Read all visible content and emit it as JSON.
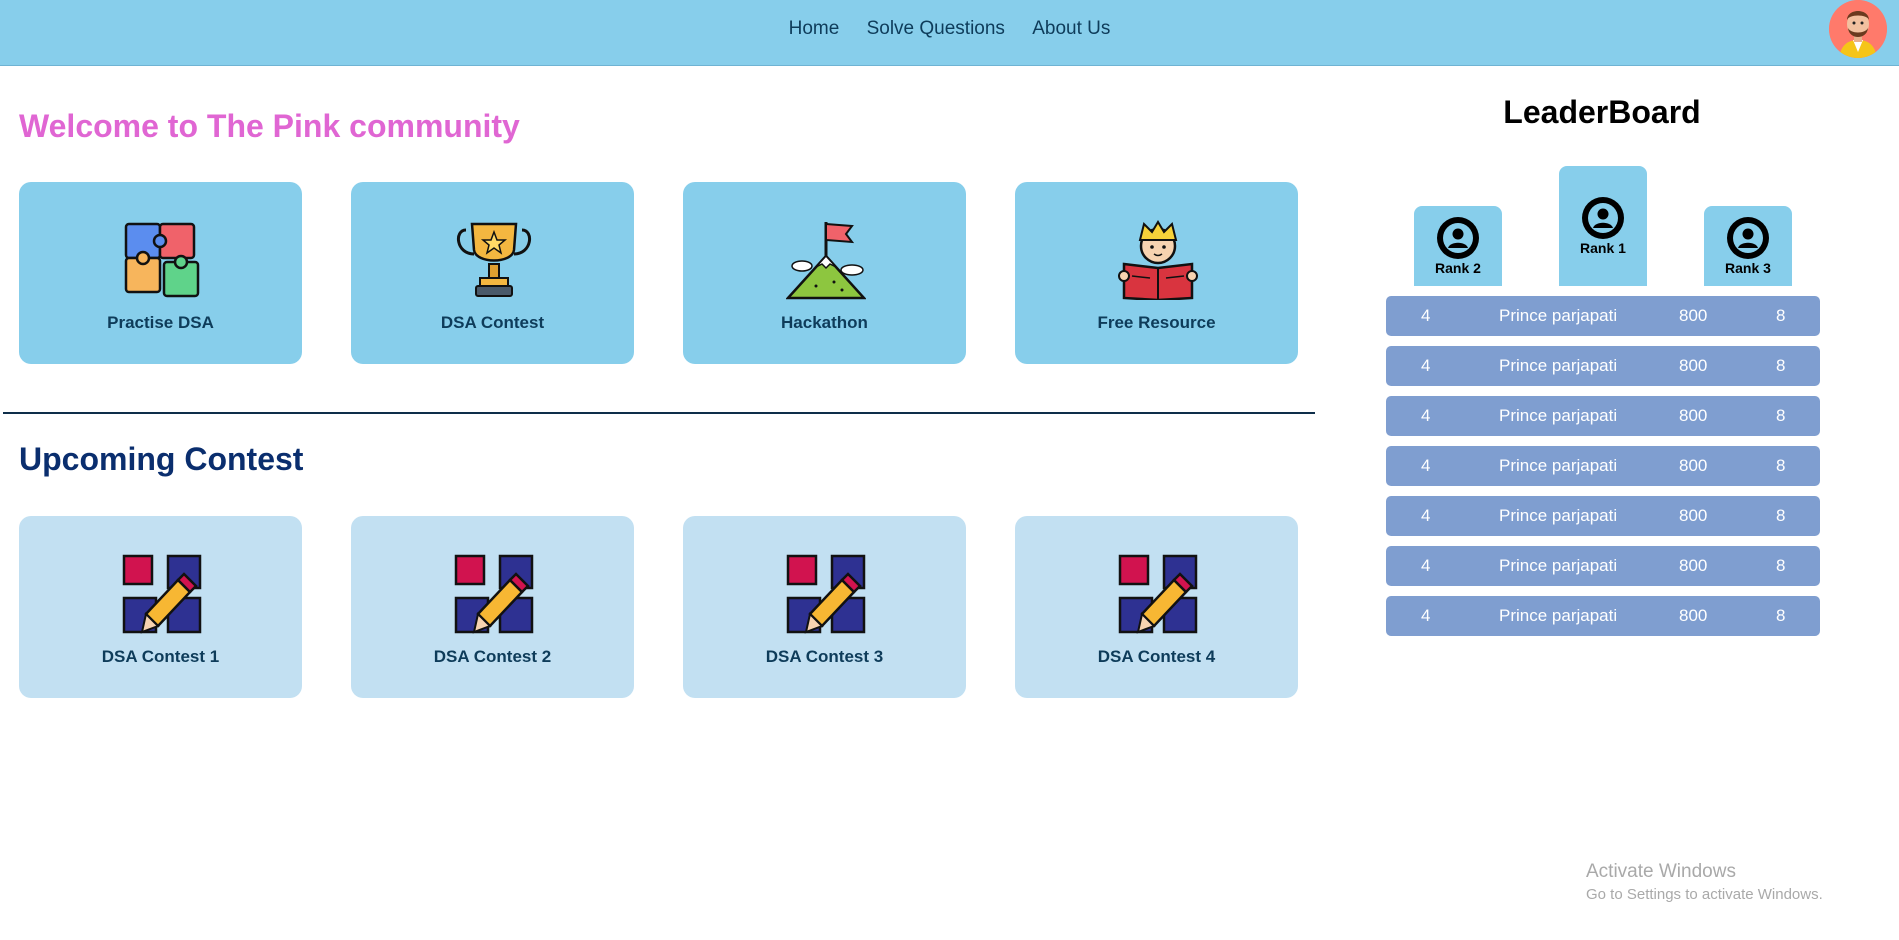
{
  "nav": {
    "links": [
      "Home",
      "Solve Questions",
      "About Us"
    ]
  },
  "welcome": {
    "title": "Welcome to The Pink community",
    "cards": [
      {
        "label": "Practise DSA",
        "icon": "puzzle-icon"
      },
      {
        "label": "DSA Contest",
        "icon": "trophy-icon"
      },
      {
        "label": "Hackathon",
        "icon": "mountain-flag-icon"
      },
      {
        "label": "Free Resource",
        "icon": "reading-kid-icon"
      }
    ]
  },
  "upcoming": {
    "title": "Upcoming Contest",
    "cards": [
      {
        "label": "DSA Contest 1",
        "icon": "blocks-pencil-icon"
      },
      {
        "label": "DSA Contest 2",
        "icon": "blocks-pencil-icon"
      },
      {
        "label": "DSA Contest 3",
        "icon": "blocks-pencil-icon"
      },
      {
        "label": "DSA Contest 4",
        "icon": "blocks-pencil-icon"
      }
    ]
  },
  "leaderboard": {
    "title": "LeaderBoard",
    "podium": {
      "second": "Rank 2",
      "first": "Rank 1",
      "third": "Rank 3"
    },
    "rows": [
      {
        "rank": "4",
        "name": "Prince parjapati",
        "score": "800",
        "solved": "8"
      },
      {
        "rank": "4",
        "name": "Prince parjapati",
        "score": "800",
        "solved": "8"
      },
      {
        "rank": "4",
        "name": "Prince parjapati",
        "score": "800",
        "solved": "8"
      },
      {
        "rank": "4",
        "name": "Prince parjapati",
        "score": "800",
        "solved": "8"
      },
      {
        "rank": "4",
        "name": "Prince parjapati",
        "score": "800",
        "solved": "8"
      },
      {
        "rank": "4",
        "name": "Prince parjapati",
        "score": "800",
        "solved": "8"
      },
      {
        "rank": "4",
        "name": "Prince parjapati",
        "score": "800",
        "solved": "8"
      }
    ]
  },
  "watermark": {
    "line1": "Activate Windows",
    "line2": "Go to Settings to activate Windows."
  },
  "colors": {
    "nav_bg": "#87ceeb",
    "welcome_title": "#e066d3",
    "upcoming_title": "#0a2e6e",
    "feature_card": "#87ceeb",
    "contest_card": "#c2e0f2",
    "leaderboard_row": "#7f9ed0"
  }
}
